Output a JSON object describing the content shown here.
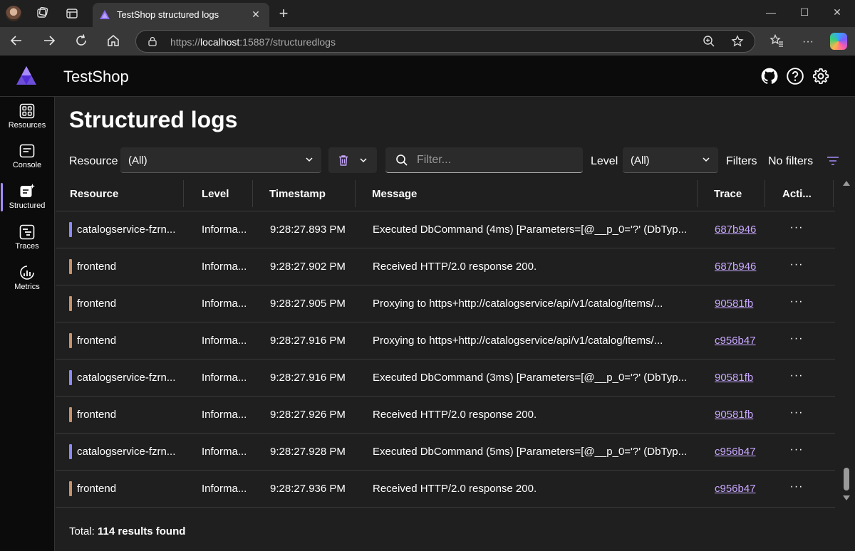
{
  "browser": {
    "tab_title": "TestShop structured logs",
    "tab_close": "✕",
    "new_tab": "+",
    "url_scheme": "https://",
    "url_host": "localhost",
    "url_rest": ":15887/structuredlogs"
  },
  "app": {
    "title": "TestShop",
    "accent": "#a78bfa"
  },
  "sidebar": {
    "items": [
      {
        "label": "Resources",
        "icon": "resources-icon"
      },
      {
        "label": "Console",
        "icon": "console-icon"
      },
      {
        "label": "Structured",
        "icon": "structured-icon",
        "active": true
      },
      {
        "label": "Traces",
        "icon": "traces-icon"
      },
      {
        "label": "Metrics",
        "icon": "metrics-icon"
      }
    ]
  },
  "page": {
    "title": "Structured logs",
    "resource_label": "Resource",
    "resource_value": "(All)",
    "filter_placeholder": "Filter...",
    "level_label": "Level",
    "level_value": "(All)",
    "filters_label": "Filters",
    "filters_value": "No filters"
  },
  "table": {
    "headers": {
      "resource": "Resource",
      "level": "Level",
      "timestamp": "Timestamp",
      "message": "Message",
      "trace": "Trace",
      "actions": "Acti..."
    },
    "rows": [
      {
        "resource": "catalogservice-fzrn...",
        "color": "#8b8cf8",
        "level": "Informa...",
        "timestamp": "9:28:27.893 PM",
        "message": "Executed DbCommand (4ms) [Parameters=[@__p_0='?' (DbTyp...",
        "trace": "687b946"
      },
      {
        "resource": "frontend",
        "color": "#c8936a",
        "level": "Informa...",
        "timestamp": "9:28:27.902 PM",
        "message": "Received HTTP/2.0 response 200.",
        "trace": "687b946"
      },
      {
        "resource": "frontend",
        "color": "#c8936a",
        "level": "Informa...",
        "timestamp": "9:28:27.905 PM",
        "message": "Proxying to https+http://catalogservice/api/v1/catalog/items/...",
        "trace": "90581fb"
      },
      {
        "resource": "frontend",
        "color": "#c8936a",
        "level": "Informa...",
        "timestamp": "9:28:27.916 PM",
        "message": "Proxying to https+http://catalogservice/api/v1/catalog/items/...",
        "trace": "c956b47"
      },
      {
        "resource": "catalogservice-fzrn...",
        "color": "#8b8cf8",
        "level": "Informa...",
        "timestamp": "9:28:27.916 PM",
        "message": "Executed DbCommand (3ms) [Parameters=[@__p_0='?' (DbTyp...",
        "trace": "90581fb"
      },
      {
        "resource": "frontend",
        "color": "#c8936a",
        "level": "Informa...",
        "timestamp": "9:28:27.926 PM",
        "message": "Received HTTP/2.0 response 200.",
        "trace": "90581fb"
      },
      {
        "resource": "catalogservice-fzrn...",
        "color": "#8b8cf8",
        "level": "Informa...",
        "timestamp": "9:28:27.928 PM",
        "message": "Executed DbCommand (5ms) [Parameters=[@__p_0='?' (DbTyp...",
        "trace": "c956b47"
      },
      {
        "resource": "frontend",
        "color": "#c8936a",
        "level": "Informa...",
        "timestamp": "9:28:27.936 PM",
        "message": "Received HTTP/2.0 response 200.",
        "trace": "c956b47"
      }
    ],
    "actions_glyph": "···"
  },
  "footer": {
    "total_label": "Total:",
    "total_value": "114 results found"
  }
}
